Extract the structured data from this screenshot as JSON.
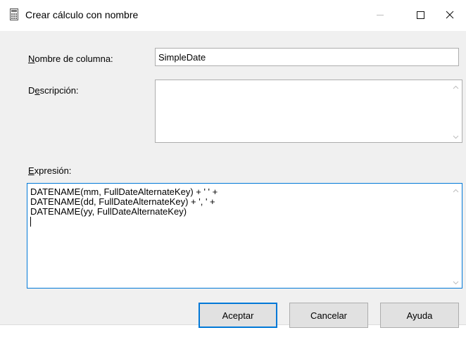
{
  "window": {
    "title": "Crear cálculo con nombre"
  },
  "form": {
    "column_name": {
      "label_first": "N",
      "label_rest": "ombre de columna:",
      "value": "SimpleDate"
    },
    "description": {
      "label_first": "D",
      "label_mid": "e",
      "label_u": "s",
      "label_rest": "cripción:",
      "value": ""
    },
    "expression": {
      "label_first": "E",
      "label_rest": "xpresión:",
      "lines": [
        "DATENAME(mm, FullDateAlternateKey) + ' ' +",
        "DATENAME(dd, FullDateAlternateKey) + ', ' +",
        "DATENAME(yy, FullDateAlternateKey)"
      ]
    }
  },
  "buttons": {
    "ok": "Aceptar",
    "cancel": "Cancelar",
    "help": "Ayuda"
  },
  "colors": {
    "accent": "#0078d7",
    "background": "#f0f0f0",
    "button": "#e1e1e1"
  }
}
